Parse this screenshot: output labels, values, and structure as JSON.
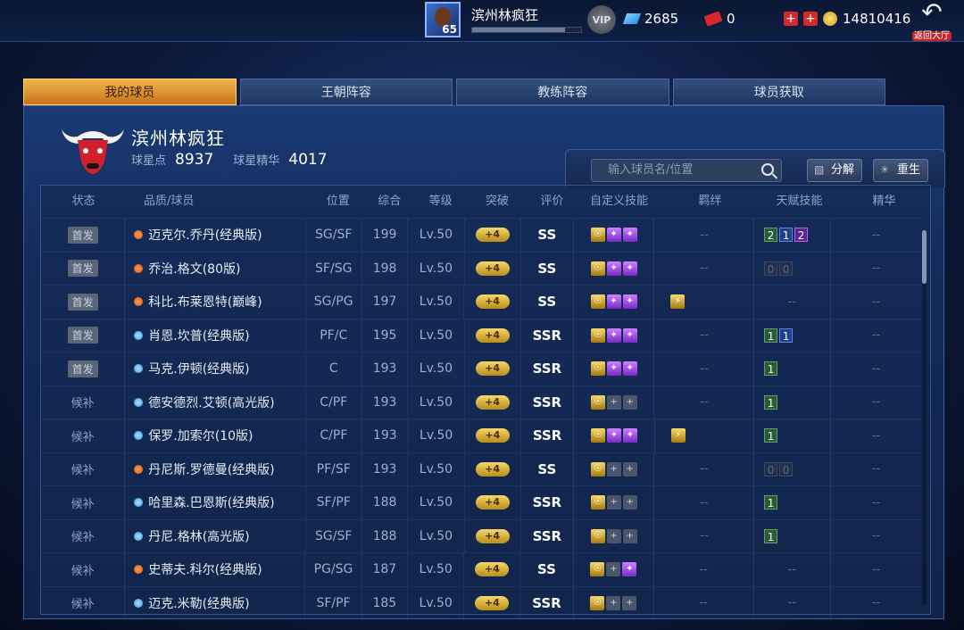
{
  "topbar": {
    "user_name": "滨州林疯狂",
    "level": "65",
    "xp_fraction": 0.85,
    "vip_label": "VIP",
    "gems": "2685",
    "tickets": "0",
    "coins": "14810416",
    "back_label": "返回大厅",
    "icons": [
      "avatar",
      "vip-badge-icon",
      "gem-icon",
      "ticket-icon",
      "plus-icon",
      "coin-icon",
      "back-arrow-icon"
    ]
  },
  "tabs": [
    {
      "label": "我的球员",
      "active": true
    },
    {
      "label": "王朝阵容",
      "active": false
    },
    {
      "label": "教练阵容",
      "active": false
    },
    {
      "label": "球员获取",
      "active": false
    }
  ],
  "team": {
    "name": "滨州林疯狂",
    "star_points_label": "球星点",
    "star_points": "8937",
    "essence_label": "球星精华",
    "essence": "4017"
  },
  "toolbar": {
    "search_placeholder": "输入球员名/位置",
    "decompose_label": "分解",
    "reborn_label": "重生"
  },
  "columns": [
    "状态",
    "品质/球员",
    "位置",
    "综合",
    "等级",
    "突破",
    "评价",
    "自定义技能",
    "羁绊",
    "天赋技能",
    "精华"
  ],
  "players": [
    {
      "status": "首发",
      "starter": true,
      "quality": "orange",
      "name": "迈克尔.乔丹(经典版)",
      "pos": "SG/SF",
      "ovr": "199",
      "lv": "Lv.50",
      "break": "+4",
      "grade": "SS",
      "skills": [
        "gold",
        "purple",
        "purple"
      ],
      "bond": "--",
      "talents": [
        [
          "2",
          "t-green"
        ],
        [
          "1",
          "t-blue"
        ],
        [
          "2",
          "t-purple"
        ]
      ],
      "essence": "--"
    },
    {
      "status": "首发",
      "starter": true,
      "quality": "orange",
      "name": "乔治.格文(80版)",
      "pos": "SF/SG",
      "ovr": "198",
      "lv": "Lv.50",
      "break": "+4",
      "grade": "SS",
      "skills": [
        "gold",
        "purple",
        "purple"
      ],
      "bond": "--",
      "talents": [
        [
          "0",
          "t-dim"
        ],
        [
          "0",
          "t-dim"
        ]
      ],
      "essence": "--"
    },
    {
      "status": "首发",
      "starter": true,
      "quality": "orange",
      "name": "科比.布莱恩特(巅峰)",
      "pos": "SG/PG",
      "ovr": "197",
      "lv": "Lv.50",
      "break": "+4",
      "grade": "SS",
      "skills": [
        "gold",
        "purple",
        "purple"
      ],
      "bond": "icon",
      "talents": [],
      "essence": "--"
    },
    {
      "status": "首发",
      "starter": true,
      "quality": "blue",
      "name": "肖恩.坎普(经典版)",
      "pos": "PF/C",
      "ovr": "195",
      "lv": "Lv.50",
      "break": "+4",
      "grade": "SSR",
      "skills": [
        "gold",
        "purple",
        "purple"
      ],
      "bond": "--",
      "talents": [
        [
          "1",
          "t-green"
        ],
        [
          "1",
          "t-blue"
        ]
      ],
      "essence": "--"
    },
    {
      "status": "首发",
      "starter": true,
      "quality": "blue",
      "name": "马克.伊顿(经典版)",
      "pos": "C",
      "ovr": "193",
      "lv": "Lv.50",
      "break": "+4",
      "grade": "SSR",
      "skills": [
        "gold",
        "purple",
        "purple"
      ],
      "bond": "--",
      "talents": [
        [
          "1",
          "t-green"
        ]
      ],
      "essence": "--"
    },
    {
      "status": "候补",
      "starter": false,
      "quality": "blue",
      "name": "德安德烈.艾顿(高光版)",
      "pos": "C/PF",
      "ovr": "193",
      "lv": "Lv.50",
      "break": "+4",
      "grade": "SSR",
      "skills": [
        "gold",
        "empty",
        "empty"
      ],
      "bond": "--",
      "talents": [
        [
          "1",
          "t-green"
        ]
      ],
      "essence": "--"
    },
    {
      "status": "候补",
      "starter": false,
      "quality": "blue",
      "name": "保罗.加索尔(10版)",
      "pos": "C/PF",
      "ovr": "193",
      "lv": "Lv.50",
      "break": "+4",
      "grade": "SSR",
      "skills": [
        "gold",
        "purple",
        "purple"
      ],
      "bond": "icon",
      "talents": [
        [
          "1",
          "t-green"
        ]
      ],
      "essence": "--"
    },
    {
      "status": "候补",
      "starter": false,
      "quality": "orange",
      "name": "丹尼斯.罗德曼(经典版)",
      "pos": "PF/SF",
      "ovr": "193",
      "lv": "Lv.50",
      "break": "+4",
      "grade": "SS",
      "skills": [
        "gold",
        "empty",
        "empty"
      ],
      "bond": "--",
      "talents": [
        [
          "0",
          "t-dim"
        ],
        [
          "0",
          "t-dim"
        ]
      ],
      "essence": "--"
    },
    {
      "status": "候补",
      "starter": false,
      "quality": "blue",
      "name": "哈里森.巴恩斯(经典版)",
      "pos": "SF/PF",
      "ovr": "188",
      "lv": "Lv.50",
      "break": "+4",
      "grade": "SSR",
      "skills": [
        "gold",
        "empty",
        "empty"
      ],
      "bond": "--",
      "talents": [
        [
          "1",
          "t-green"
        ]
      ],
      "essence": "--"
    },
    {
      "status": "候补",
      "starter": false,
      "quality": "blue",
      "name": "丹尼.格林(高光版)",
      "pos": "SG/SF",
      "ovr": "188",
      "lv": "Lv.50",
      "break": "+4",
      "grade": "SSR",
      "skills": [
        "gold",
        "empty",
        "empty"
      ],
      "bond": "--",
      "talents": [
        [
          "1",
          "t-green"
        ]
      ],
      "essence": "--"
    },
    {
      "status": "候补",
      "starter": false,
      "quality": "orange",
      "name": "史蒂夫.科尔(经典版)",
      "pos": "PG/SG",
      "ovr": "187",
      "lv": "Lv.50",
      "break": "+4",
      "grade": "SS",
      "skills": [
        "gold",
        "empty",
        "purple"
      ],
      "bond": "--",
      "talents": [],
      "essence": "--"
    },
    {
      "status": "候补",
      "starter": false,
      "quality": "blue",
      "name": "迈克.米勒(经典版)",
      "pos": "SF/PF",
      "ovr": "185",
      "lv": "Lv.50",
      "break": "+4",
      "grade": "SSR",
      "skills": [
        "gold",
        "empty",
        "empty"
      ],
      "bond": "--",
      "talents": [],
      "essence": "--"
    }
  ]
}
